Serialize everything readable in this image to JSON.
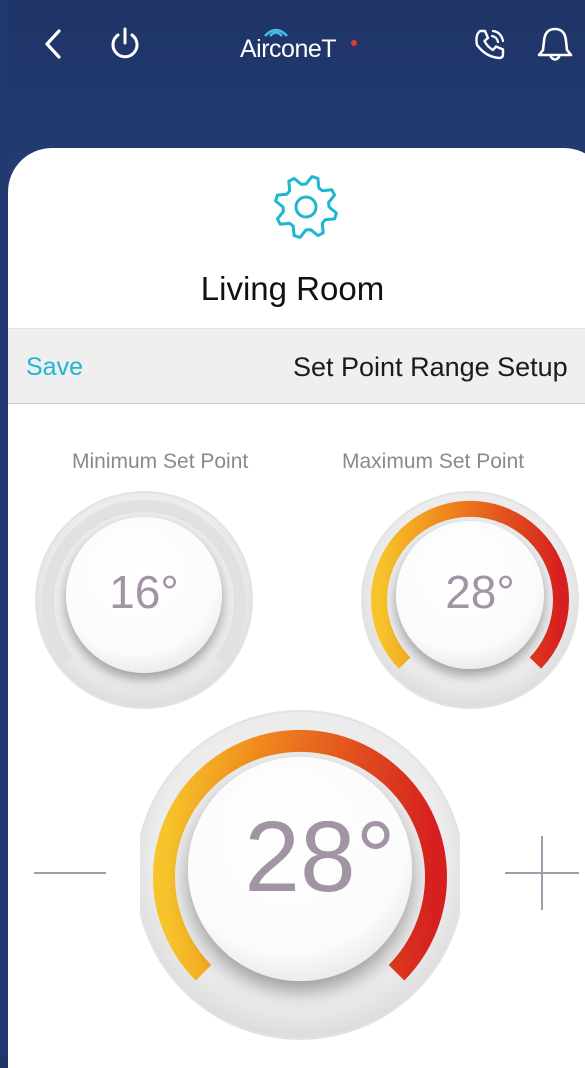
{
  "header": {
    "logo_text": "AirconeT",
    "icons": [
      "back-icon",
      "power-icon",
      "phone-icon",
      "bell-icon"
    ]
  },
  "device": {
    "icon": "gear-icon",
    "name": "Living Room"
  },
  "setpoint_bar": {
    "save_label": "Save",
    "title": "Set Point Range Setup"
  },
  "min_setpoint": {
    "label": "Minimum Set Point",
    "value": "16°"
  },
  "max_setpoint": {
    "label": "Maximum Set Point",
    "value": "28°"
  },
  "main_dial": {
    "value": "28°",
    "decrease_icon": "minus-icon",
    "increase_icon": "plus-icon"
  },
  "colors": {
    "header_bg": "#1f3568",
    "accent": "#1fb6cf",
    "arc_start": "#f7c52b",
    "arc_mid": "#f08a1d",
    "arc_end": "#d61f1f",
    "value_text": "#a194a4"
  }
}
